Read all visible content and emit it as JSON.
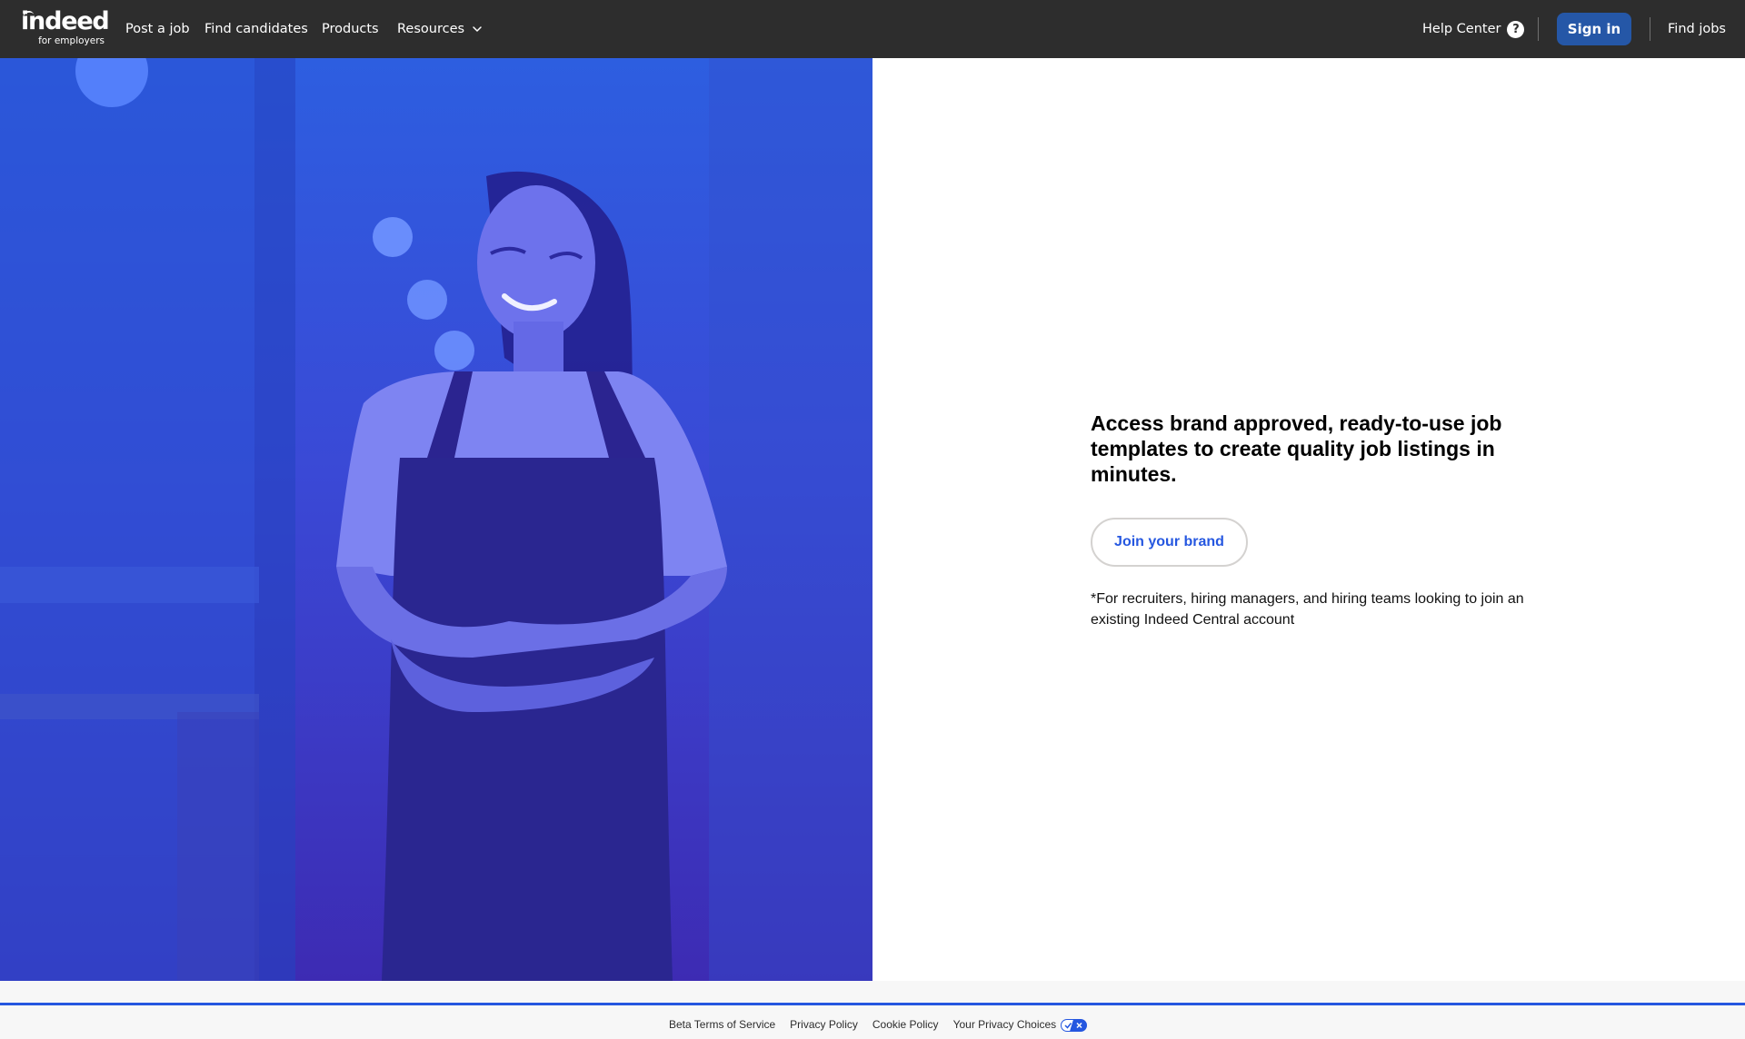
{
  "header": {
    "logo": {
      "name": "indeed",
      "subtitle": "for employers"
    },
    "nav": {
      "post_job": "Post a job",
      "find_candidates": "Find candidates",
      "products": "Products",
      "resources": "Resources"
    },
    "help_center": "Help Center",
    "sign_in": "Sign in",
    "find_jobs": "Find jobs"
  },
  "hero": {
    "heading": "Access brand approved, ready-to-use job templates to create quality job listings in minutes.",
    "cta": "Join your brand",
    "note": "*For recruiters, hiring managers, and hiring teams looking to join an existing Indeed Central account"
  },
  "footer": {
    "links": [
      "Beta Terms of Service",
      "Privacy Policy",
      "Cookie Policy",
      "Your Privacy Choices"
    ]
  },
  "colors": {
    "header_bg": "#2d2d2d",
    "brand_blue": "#2557a7",
    "link_blue": "#2557e0",
    "hero_gradient_top": "#2d5ee0",
    "hero_gradient_bottom": "#3d2bb3"
  }
}
